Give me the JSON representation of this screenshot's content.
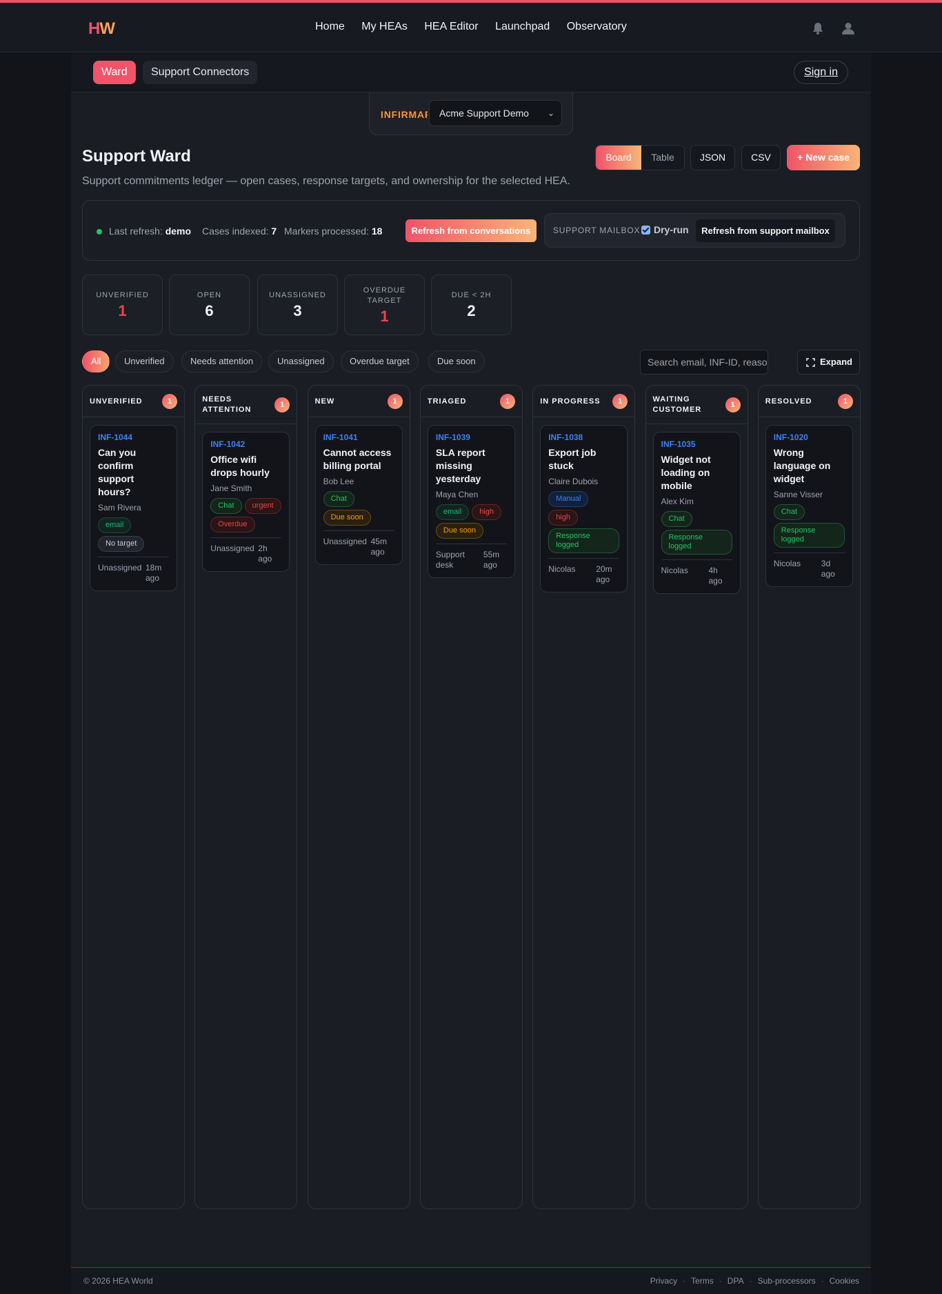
{
  "brand": {
    "logo_h": "H",
    "logo_w": "W"
  },
  "nav": {
    "items": [
      "Home",
      "My HEAs",
      "HEA Editor",
      "Launchpad",
      "Observatory"
    ]
  },
  "subnav": {
    "ward": "Ward",
    "support_connectors": "Support Connectors",
    "signin": "Sign in"
  },
  "infirmary": {
    "label": "INFIRMARY",
    "selected": "Acme Support Demo"
  },
  "page": {
    "title": "Support Ward",
    "subtitle": "Support commitments ledger — open cases, response targets, and ownership for the selected HEA."
  },
  "toolbar": {
    "board": "Board",
    "table": "Table",
    "json": "JSON",
    "csv": "CSV",
    "new_case": "+ New case"
  },
  "refresh": {
    "last_refresh_label": "Last refresh:",
    "last_refresh_value": "demo",
    "cases_label": "Cases indexed:",
    "cases_value": "7",
    "markers_label": "Markers processed:",
    "markers_value": "18",
    "refresh_conversations": "Refresh from conversations",
    "mailbox_label": "SUPPORT MAILBOX",
    "dry_run": "Dry-run",
    "dry_run_checked": true,
    "refresh_mailbox": "Refresh from support mailbox"
  },
  "kpis": [
    {
      "label": "UNVERIFIED",
      "value": "1",
      "alert": true
    },
    {
      "label": "OPEN",
      "value": "6",
      "alert": false
    },
    {
      "label": "UNASSIGNED",
      "value": "3",
      "alert": false
    },
    {
      "label": "OVERDUE TARGET",
      "value": "1",
      "alert": true
    },
    {
      "label": "DUE < 2H",
      "value": "2",
      "alert": false
    }
  ],
  "filters": [
    "All",
    "Unverified",
    "Needs attention",
    "Unassigned",
    "Overdue target",
    "Due soon"
  ],
  "active_filter": "All",
  "search": {
    "placeholder": "Search email, INF-ID, reason…"
  },
  "expand": "Expand",
  "columns": [
    {
      "title": "UNVERIFIED",
      "count": "1",
      "cards": [
        {
          "id": "INF-1044",
          "title": "Can you confirm support hours?",
          "person": "Sam Rivera",
          "tags": [
            {
              "text": "email",
              "color": "teal"
            },
            {
              "text": "No target",
              "color": "gray"
            }
          ],
          "owner": "Unassigned",
          "age": "18m ago"
        }
      ]
    },
    {
      "title": "NEEDS ATTENTION",
      "count": "1",
      "cards": [
        {
          "id": "INF-1042",
          "title": "Office wifi drops hourly",
          "person": "Jane Smith",
          "tags": [
            {
              "text": "Chat",
              "color": "green"
            },
            {
              "text": "urgent",
              "color": "red"
            },
            {
              "text": "Overdue",
              "color": "red"
            }
          ],
          "owner": "Unassigned",
          "age": "2h ago"
        }
      ]
    },
    {
      "title": "NEW",
      "count": "1",
      "cards": [
        {
          "id": "INF-1041",
          "title": "Cannot access billing portal",
          "person": "Bob Lee",
          "tags": [
            {
              "text": "Chat",
              "color": "green"
            },
            {
              "text": "Due soon",
              "color": "amber"
            }
          ],
          "owner": "Unassigned",
          "age": "45m ago"
        }
      ]
    },
    {
      "title": "TRIAGED",
      "count": "1",
      "cards": [
        {
          "id": "INF-1039",
          "title": "SLA report missing yesterday",
          "person": "Maya Chen",
          "tags": [
            {
              "text": "email",
              "color": "teal"
            },
            {
              "text": "high",
              "color": "red"
            },
            {
              "text": "Due soon",
              "color": "amber"
            }
          ],
          "owner": "Support desk",
          "age": "55m ago"
        }
      ]
    },
    {
      "title": "IN PROGRESS",
      "count": "1",
      "cards": [
        {
          "id": "INF-1038",
          "title": "Export job stuck",
          "person": "Claire Dubois",
          "tags": [
            {
              "text": "Manual",
              "color": "blue"
            },
            {
              "text": "high",
              "color": "red"
            },
            {
              "text": "Response logged",
              "color": "green"
            }
          ],
          "owner": "Nicolas",
          "age": "20m ago"
        }
      ]
    },
    {
      "title": "WAITING CUSTOMER",
      "count": "1",
      "cards": [
        {
          "id": "INF-1035",
          "title": "Widget not loading on mobile",
          "person": "Alex Kim",
          "tags": [
            {
              "text": "Chat",
              "color": "green"
            },
            {
              "text": "Response logged",
              "color": "green"
            }
          ],
          "owner": "Nicolas",
          "age": "4h ago"
        }
      ]
    },
    {
      "title": "RESOLVED",
      "count": "1",
      "cards": [
        {
          "id": "INF-1020",
          "title": "Wrong language on widget",
          "person": "Sanne Visser",
          "tags": [
            {
              "text": "Chat",
              "color": "green"
            },
            {
              "text": "Response logged",
              "color": "green"
            }
          ],
          "owner": "Nicolas",
          "age": "3d ago"
        }
      ]
    }
  ],
  "footer": {
    "copyright": "© 2026 HEA World",
    "links": [
      "Privacy",
      "Terms",
      "DPA",
      "Sub-processors",
      "Cookies"
    ]
  }
}
